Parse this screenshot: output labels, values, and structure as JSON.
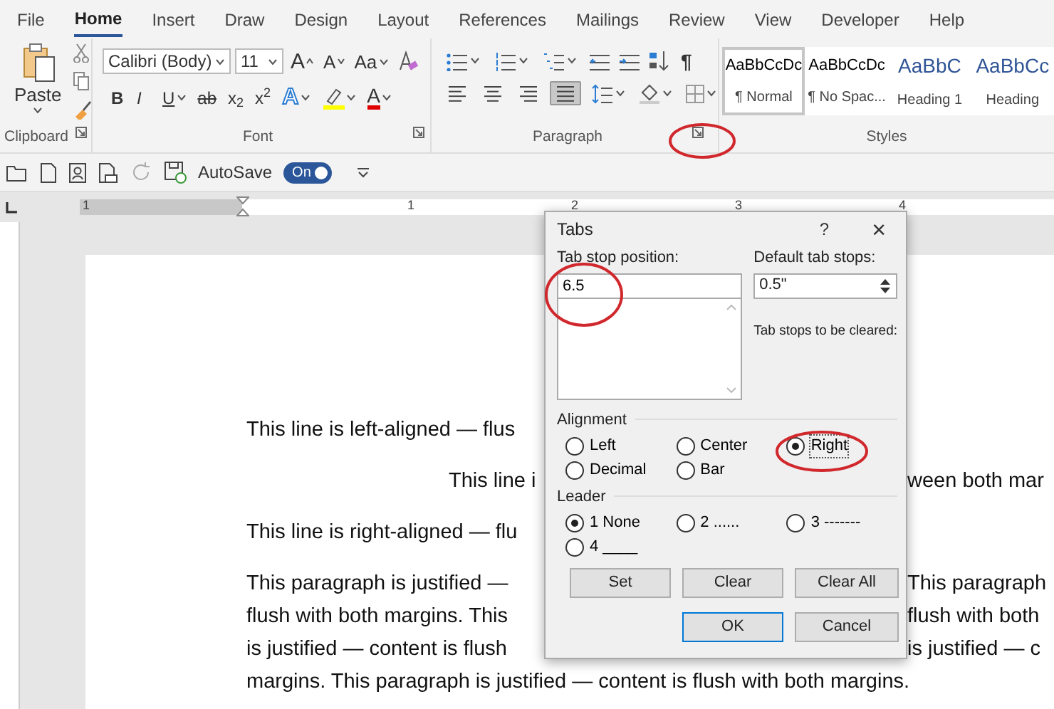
{
  "menu_tabs": [
    {
      "label": "File",
      "selected": false
    },
    {
      "label": "Home",
      "selected": true
    },
    {
      "label": "Insert",
      "selected": false
    },
    {
      "label": "Draw",
      "selected": false
    },
    {
      "label": "Design",
      "selected": false
    },
    {
      "label": "Layout",
      "selected": false
    },
    {
      "label": "References",
      "selected": false
    },
    {
      "label": "Mailings",
      "selected": false
    },
    {
      "label": "Review",
      "selected": false
    },
    {
      "label": "View",
      "selected": false
    },
    {
      "label": "Developer",
      "selected": false
    },
    {
      "label": "Help",
      "selected": false
    }
  ],
  "clipboard": {
    "paste": "Paste",
    "group": "Clipboard"
  },
  "font": {
    "name": "Calibri (Body)",
    "size": "11",
    "grow": "A",
    "shrink": "A",
    "change_case": "Aa",
    "format_buttons": [
      "B",
      "I",
      "U",
      "ab",
      "x$_{2}$",
      "x$^{2}$"
    ],
    "effects": "A",
    "font_color": "A",
    "group": "Font"
  },
  "paragraph": {
    "show_marks": "¶",
    "alignment_buttons": [
      {
        "kind": "left",
        "selected": false
      },
      {
        "kind": "center",
        "selected": false
      },
      {
        "kind": "right",
        "selected": false
      },
      {
        "kind": "justify",
        "selected": true
      }
    ],
    "group": "Paragraph"
  },
  "styles": {
    "items": [
      {
        "preview": "AaBbCcDc",
        "name": "¶ Normal",
        "kind": "body",
        "selected": true
      },
      {
        "preview": "AaBbCcDc",
        "name": "¶ No Spac...",
        "kind": "body",
        "selected": false
      },
      {
        "preview": "AaBbC",
        "name": "Heading 1",
        "kind": "heading",
        "selected": false
      },
      {
        "preview": "AaBbCc",
        "name": "Heading",
        "kind": "heading",
        "selected": false
      }
    ],
    "group": "Styles"
  },
  "quick_access": {
    "autosave": "AutoSave",
    "toggle": {
      "label": "On",
      "on": true
    }
  },
  "ruler": {
    "labels": [
      "1",
      "1",
      "2",
      "3",
      "4"
    ]
  },
  "document": {
    "lines": [
      {
        "kind": "line",
        "left": "This line is left-aligned — flus"
      },
      {
        "kind": "center",
        "left": "This line i",
        "right": "ween both mar"
      },
      {
        "kind": "line",
        "left": "This line is right-aligned — flu"
      },
      {
        "kind": "para",
        "left": "This paragraph is justified —",
        "right": "This paragraph"
      },
      {
        "kind": "para",
        "left": "flush with both margins. This",
        "right": "flush with both"
      },
      {
        "kind": "para",
        "left": "is justified — content is flush",
        "right": "is justified — c"
      },
      {
        "kind": "para",
        "left": "margins. This paragraph is justified — content is flush with both margins."
      }
    ]
  },
  "dialog": {
    "title": "Tabs",
    "help": "?",
    "close": "×",
    "position_label": "Tab stop position:",
    "position_value": "6.5",
    "default_label": "Default tab stops:",
    "default_value": "0.5\"",
    "cleared_label": "Tab stops to be cleared:",
    "alignment_label": "Alignment",
    "alignment": [
      {
        "label": "Left",
        "selected": false
      },
      {
        "label": "Center",
        "selected": false
      },
      {
        "label": "Right",
        "selected": true
      },
      {
        "label": "Decimal",
        "selected": false
      },
      {
        "label": "Bar",
        "selected": false
      }
    ],
    "leader_label": "Leader",
    "leader": [
      {
        "label": "1 None",
        "selected": true
      },
      {
        "label": "2 ......",
        "selected": false
      },
      {
        "label": "3 -------",
        "selected": false
      },
      {
        "label": "4 ____",
        "selected": false
      }
    ],
    "buttons": [
      {
        "label": "Set",
        "kind": "normal"
      },
      {
        "label": "Clear",
        "kind": "normal"
      },
      {
        "label": "Clear All",
        "kind": "normal"
      },
      {
        "label": "OK",
        "kind": "default"
      },
      {
        "label": "Cancel",
        "kind": "normal"
      }
    ]
  }
}
